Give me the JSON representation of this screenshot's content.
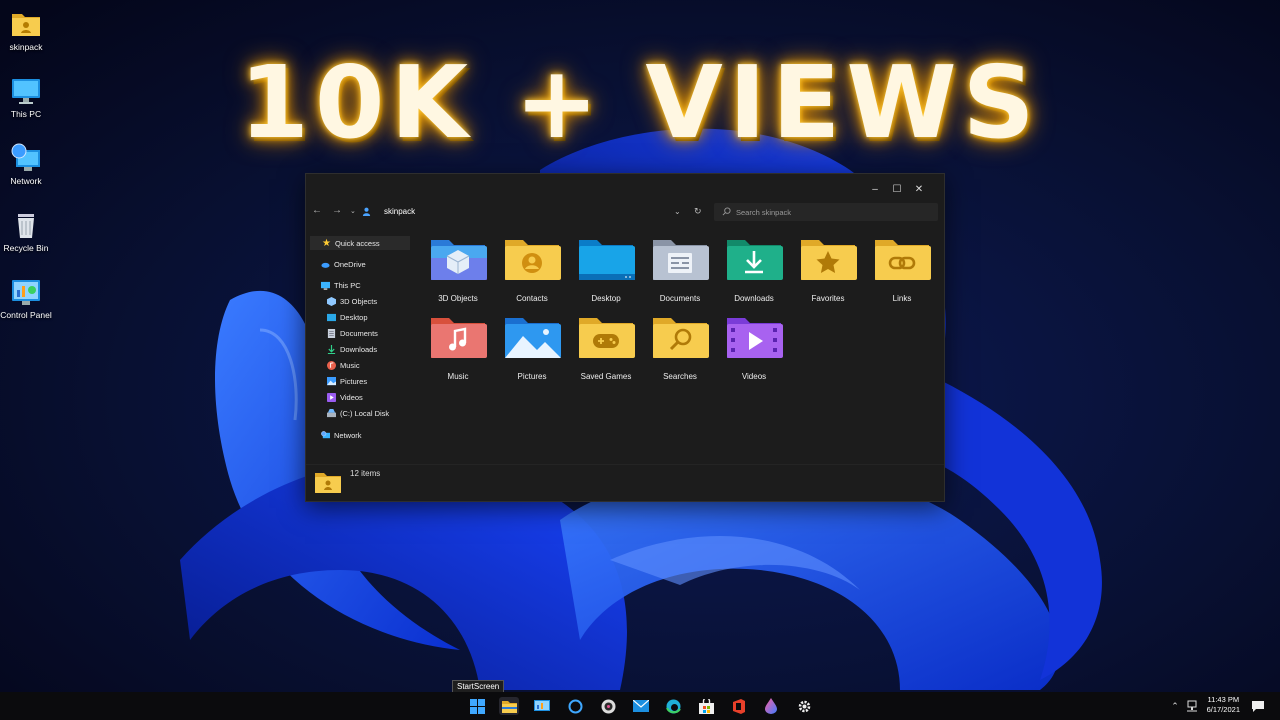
{
  "headline": "10K + VIEWS",
  "desktop_icons": [
    {
      "label": "skinpack",
      "icon": "folder-user-icon"
    },
    {
      "label": "This PC",
      "icon": "monitor-icon"
    },
    {
      "label": "Network",
      "icon": "network-icon"
    },
    {
      "label": "Recycle Bin",
      "icon": "recycle-bin-icon"
    },
    {
      "label": "Control Panel",
      "icon": "control-panel-icon"
    }
  ],
  "explorer": {
    "address": "skinpack",
    "search_placeholder": "Search skinpack",
    "sidebar": [
      {
        "label": "Quick access",
        "icon": "star-icon"
      },
      {
        "label": "OneDrive",
        "icon": "cloud-icon"
      },
      {
        "label": "This PC",
        "icon": "monitor-icon"
      },
      {
        "label": "3D Objects",
        "icon": "cube-icon"
      },
      {
        "label": "Desktop",
        "icon": "desktop-icon"
      },
      {
        "label": "Documents",
        "icon": "document-icon"
      },
      {
        "label": "Downloads",
        "icon": "download-icon"
      },
      {
        "label": "Music",
        "icon": "music-icon"
      },
      {
        "label": "Pictures",
        "icon": "picture-icon"
      },
      {
        "label": "Videos",
        "icon": "video-icon"
      },
      {
        "label": "(C:) Local Disk",
        "icon": "disk-icon"
      },
      {
        "label": "Network",
        "icon": "network-icon"
      }
    ],
    "folders": [
      {
        "label": "3D Objects",
        "icon": "cube-folder-icon"
      },
      {
        "label": "Contacts",
        "icon": "contact-folder-icon"
      },
      {
        "label": "Desktop",
        "icon": "desktop-folder-icon"
      },
      {
        "label": "Documents",
        "icon": "documents-folder-icon"
      },
      {
        "label": "Downloads",
        "icon": "downloads-folder-icon"
      },
      {
        "label": "Favorites",
        "icon": "favorites-folder-icon"
      },
      {
        "label": "Links",
        "icon": "links-folder-icon"
      },
      {
        "label": "Music",
        "icon": "music-folder-icon"
      },
      {
        "label": "Pictures",
        "icon": "pictures-folder-icon"
      },
      {
        "label": "Saved Games",
        "icon": "saved-games-folder-icon"
      },
      {
        "label": "Searches",
        "icon": "searches-folder-icon"
      },
      {
        "label": "Videos",
        "icon": "videos-folder-icon"
      }
    ],
    "status": "12 items"
  },
  "taskbar": {
    "tooltip": "StartScreen",
    "time": "11:43 PM",
    "date": "6/17/2021",
    "buttons": [
      "start-icon",
      "file-explorer-icon",
      "control-panel-icon",
      "cortana-icon",
      "media-player-icon",
      "mail-icon",
      "edge-icon",
      "store-icon",
      "office-icon",
      "paint-drop-icon",
      "settings-icon"
    ]
  },
  "colors": {
    "accent": "#1f4fff",
    "headline_glow": "#f0a000",
    "window_bg": "#1c1c1c",
    "folder_yellow": "#f6c544"
  }
}
